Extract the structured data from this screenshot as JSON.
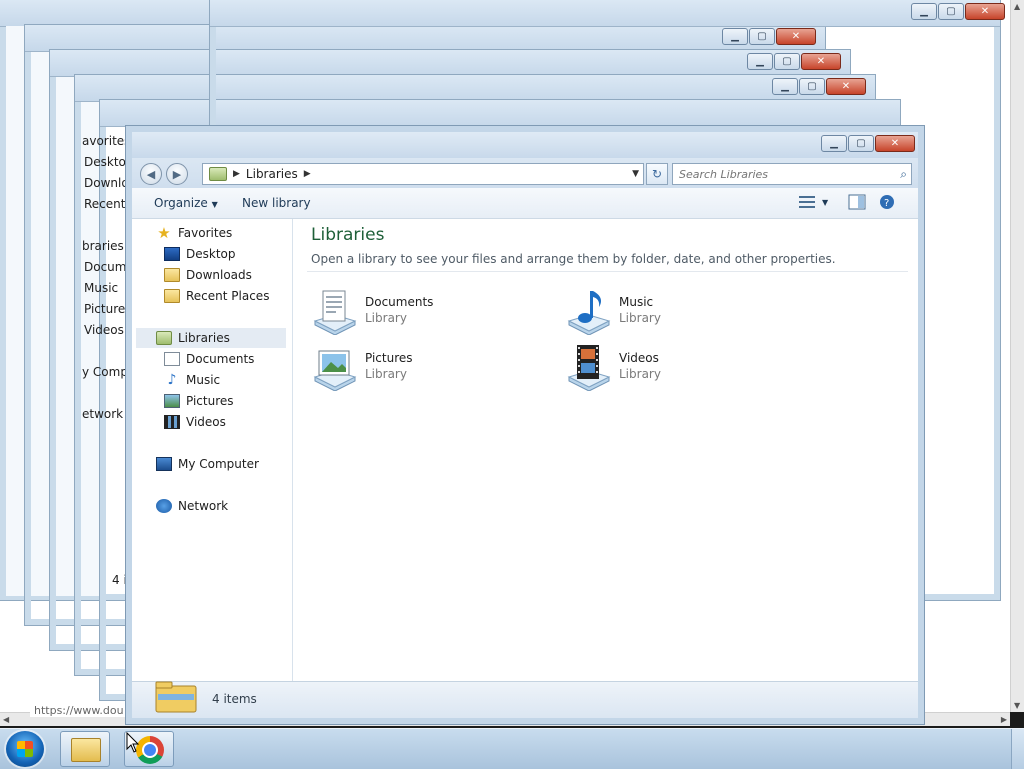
{
  "background": {
    "status_url": "https://www.dou"
  },
  "ghost_windows": {
    "labels": {
      "favorites_fragment": "avorites",
      "desktop_fragment": "Deskto",
      "downloads_fragment": "Downlo",
      "recent_fragment": "Recent P",
      "libraries_fragment": "braries",
      "documents_fragment": "Docume",
      "music": "Music",
      "pictures_fragment": "Pictures",
      "videos": "Videos",
      "computer_fragment": "y Comput",
      "network_fragment": "etwork",
      "count_fragment": "4 i"
    }
  },
  "window": {
    "address": {
      "crumb": "Libraries"
    },
    "search": {
      "placeholder": "Search Libraries"
    },
    "toolbar": {
      "organize_label": "Organize",
      "new_library_label": "New library"
    },
    "nav": {
      "favorites": "Favorites",
      "desktop": "Desktop",
      "downloads": "Downloads",
      "recent_places": "Recent Places",
      "libraries": "Libraries",
      "documents": "Documents",
      "music": "Music",
      "pictures": "Pictures",
      "videos": "Videos",
      "my_computer": "My Computer",
      "network": "Network"
    },
    "content": {
      "title": "Libraries",
      "subtitle": "Open a library to see your files and arrange them by folder, date, and other properties.",
      "libraries": [
        {
          "name": "Documents",
          "type": "Library",
          "icon": "documents-library-icon"
        },
        {
          "name": "Music",
          "type": "Library",
          "icon": "music-library-icon"
        },
        {
          "name": "Pictures",
          "type": "Library",
          "icon": "pictures-library-icon"
        },
        {
          "name": "Videos",
          "type": "Library",
          "icon": "videos-library-icon"
        }
      ]
    },
    "status": {
      "item_count": "4 items"
    }
  },
  "taskbar": {
    "apps": [
      "start-orb",
      "windows-explorer",
      "google-chrome"
    ]
  },
  "colors": {
    "title_green": "#1e5f38",
    "chrome_blue": "#c3d6e8",
    "close_red": "#c7442a"
  }
}
